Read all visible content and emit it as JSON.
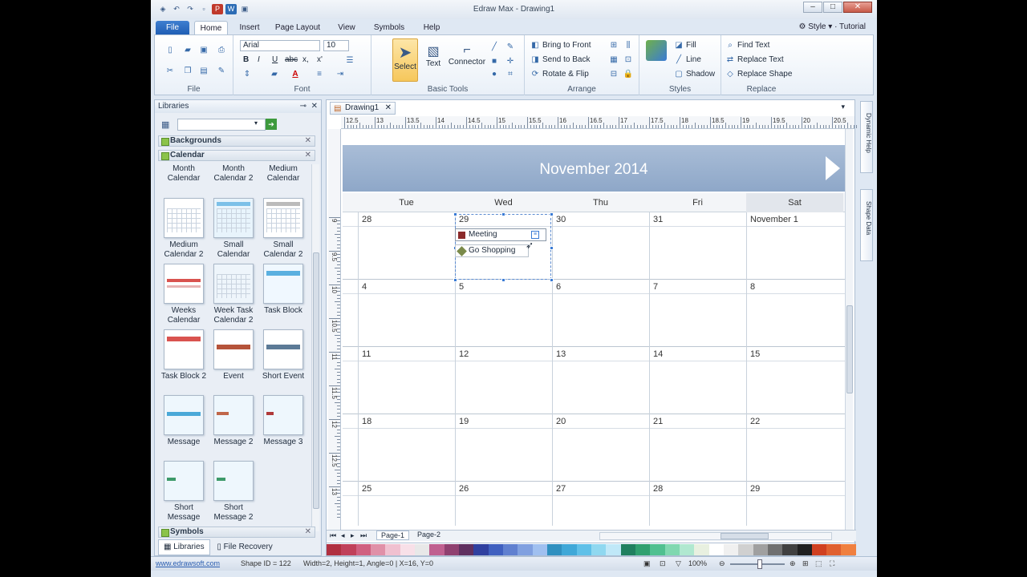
{
  "window": {
    "title": "Edraw Max - Drawing1"
  },
  "menu": {
    "file": "File",
    "tabs": [
      "Home",
      "Insert",
      "Page Layout",
      "View",
      "Symbols",
      "Help"
    ],
    "style": "Style",
    "tutorial": "Tutorial"
  },
  "ribbon": {
    "groups": {
      "file": "File",
      "font": "Font",
      "basic_tools": "Basic Tools",
      "arrange": "Arrange",
      "styles": "Styles",
      "replace": "Replace"
    },
    "font_name": "Arial",
    "font_size": "10",
    "bold": "B",
    "italic": "I",
    "underline": "U",
    "strike": "abc",
    "sub": "x,",
    "sup": "x'",
    "select": "Select",
    "text": "Text",
    "connector": "Connector",
    "bring_to_front": "Bring to Front",
    "send_to_back": "Send to Back",
    "rotate_flip": "Rotate & Flip",
    "fill": "Fill",
    "line": "Line",
    "shadow": "Shadow",
    "find_text": "Find Text",
    "replace_text": "Replace Text",
    "replace_shape": "Replace Shape"
  },
  "libraries": {
    "title": "Libraries",
    "categories": {
      "backgrounds": "Backgrounds",
      "calendar": "Calendar",
      "symbols": "Symbols"
    },
    "shapes": [
      {
        "label": "Month Calendar"
      },
      {
        "label": "Month Calendar 2"
      },
      {
        "label": "Medium Calendar"
      },
      {
        "label": "Medium Calendar 2"
      },
      {
        "label": "Small Calendar"
      },
      {
        "label": "Small Calendar 2"
      },
      {
        "label": "Weeks Calendar"
      },
      {
        "label": "Week Task Calendar 2"
      },
      {
        "label": "Task Block"
      },
      {
        "label": "Task Block 2"
      },
      {
        "label": "Event"
      },
      {
        "label": "Short Event"
      },
      {
        "label": "Message"
      },
      {
        "label": "Message 2"
      },
      {
        "label": "Message 3"
      },
      {
        "label": "Short Message"
      },
      {
        "label": "Short Message 2"
      }
    ],
    "bottom_tabs": {
      "libraries": "Libraries",
      "recovery": "File Recovery"
    }
  },
  "document": {
    "tab": "Drawing1",
    "ruler_labels": [
      "12.5",
      "13",
      "13.5",
      "14",
      "14.5",
      "15",
      "15.5",
      "16",
      "16.5",
      "17",
      "17.5",
      "18",
      "18.5",
      "19",
      "19.5",
      "20",
      "20.5"
    ],
    "vruler_labels": [
      "9",
      "9.5",
      "10",
      "10.5",
      "11",
      "11.5",
      "12",
      "12.5",
      "13"
    ],
    "pages": [
      "Page-1",
      "Page-2"
    ]
  },
  "calendar": {
    "title": "November 2014",
    "days": [
      "Tue",
      "Wed",
      "Thu",
      "Fri",
      "Sat"
    ],
    "weeks": [
      [
        "28",
        "29",
        "30",
        "31",
        "November 1"
      ],
      [
        "4",
        "5",
        "6",
        "7",
        "8"
      ],
      [
        "11",
        "12",
        "13",
        "14",
        "15"
      ],
      [
        "18",
        "19",
        "20",
        "21",
        "22"
      ],
      [
        "25",
        "26",
        "27",
        "28",
        "29"
      ]
    ],
    "events": [
      {
        "label": "Meeting",
        "color": "#8b2a2a"
      },
      {
        "label": "Go Shopping",
        "color": "#7a8a4a"
      }
    ]
  },
  "side_panels": [
    "Dynamic Help",
    "Shape Data"
  ],
  "status": {
    "site": "www.edrawsoft.com",
    "shape_id": "Shape ID = 122",
    "dims": "Width=2, Height=1, Angle=0 | X=16, Y=0",
    "zoom": "100%"
  }
}
